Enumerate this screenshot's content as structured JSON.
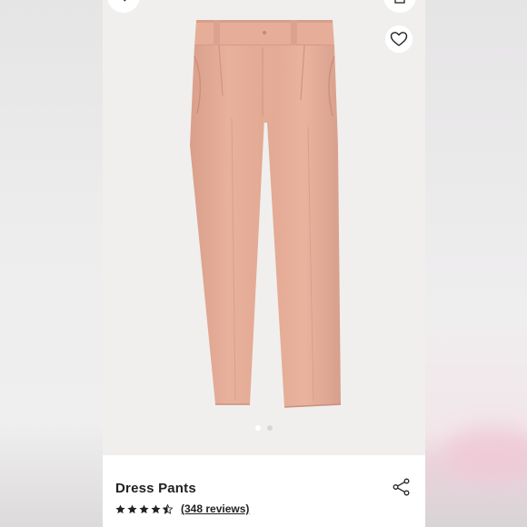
{
  "product": {
    "name": "Dress Pants",
    "image_alt": "Pale pink tapered dress pants",
    "rating": 4.5,
    "rating_max": 5,
    "reviews_label": "(348 reviews)"
  },
  "gallery": {
    "image_count": 2,
    "active_index": 0
  },
  "icons": {
    "back": "chevron-left-icon",
    "bag": "shopping-bag-icon",
    "favorite": "heart-outline-icon",
    "share": "share-icon",
    "star_full": "star-filled-icon",
    "star_half": "star-half-icon"
  },
  "colors": {
    "pants": "#e5ad98",
    "text": "#222222",
    "background": "#f0efed"
  }
}
